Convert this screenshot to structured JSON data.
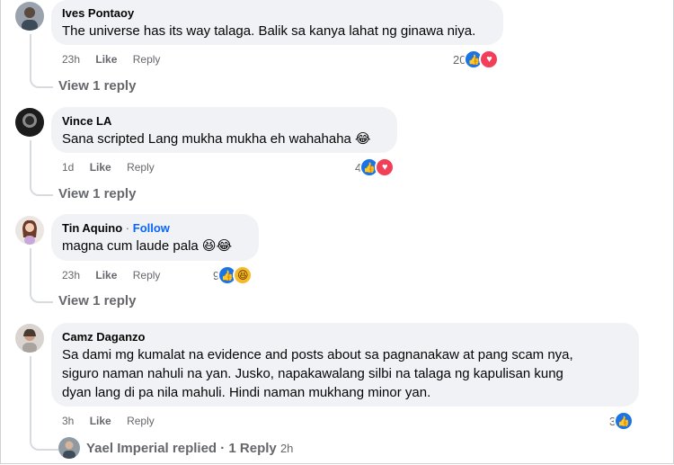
{
  "comments": [
    {
      "name": "Ives Pontaoy",
      "follow": "",
      "text": "The universe has its way talaga. Balik sa kanya lahat ng ginawa niya.",
      "time": "23h",
      "like_label": "Like",
      "reply_label": "Reply",
      "reaction_count": "20",
      "reactions": [
        "like-icon",
        "love-icon"
      ],
      "view_replies": "View 1 reply"
    },
    {
      "name": "Vince LA",
      "follow": "",
      "text": "Sana scripted Lang mukha mukha eh wahahaha 😂",
      "time": "1d",
      "like_label": "Like",
      "reply_label": "Reply",
      "reaction_count": "4",
      "reactions": [
        "like-icon",
        "love-icon"
      ],
      "view_replies": "View 1 reply"
    },
    {
      "name": "Tin Aquino",
      "follow": "Follow",
      "text": "magna cum laude pala 😆😂",
      "time": "23h",
      "like_label": "Like",
      "reply_label": "Reply",
      "reaction_count": "9",
      "reactions": [
        "like-icon",
        "haha-icon"
      ],
      "view_replies": "View 1 reply"
    },
    {
      "name": "Camz Daganzo",
      "follow": "",
      "text_lines": [
        "Sa dami mg kumalat na evidence and posts about sa pagnanakaw at pang scam nya,",
        "siguro naman nahuli na yan. Jusko, napakawalang silbi na talaga ng kapulisan kung",
        "dyan lang di pa nila mahuli. Hindi naman mukhang minor yan."
      ],
      "time": "3h",
      "like_label": "Like",
      "reply_label": "Reply",
      "reaction_count": "3",
      "reactions": [
        "like-icon"
      ],
      "replied_summary": "Yael Imperial replied · 1 Reply",
      "replied_time": "2h"
    }
  ],
  "dot": "·",
  "colors": {
    "like": "#1b74e4",
    "love": "#f33e58",
    "haha": "#f7b928",
    "link": "#0866ff",
    "meta": "#65676b",
    "bubble": "#f0f2f5"
  }
}
